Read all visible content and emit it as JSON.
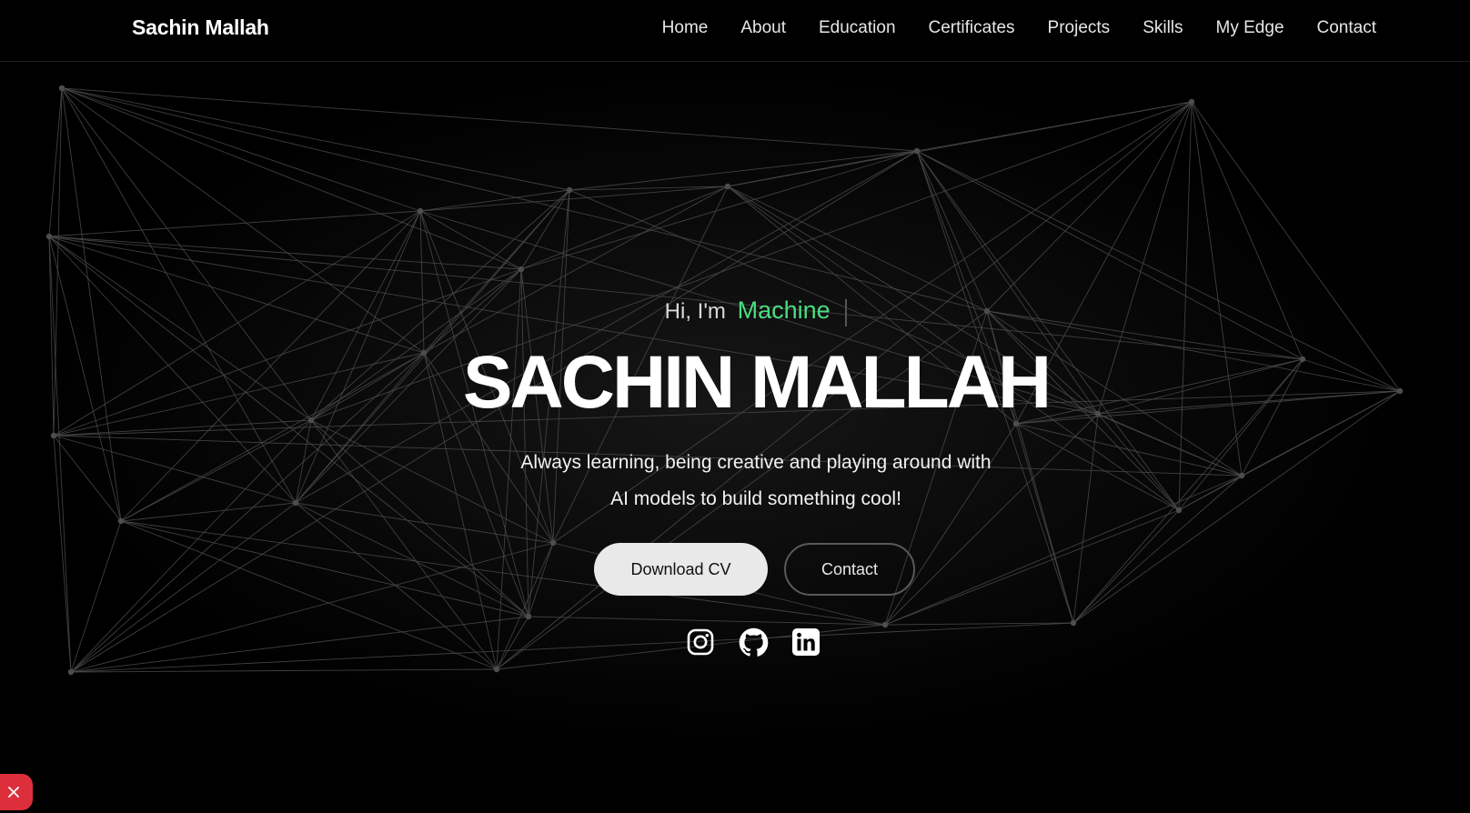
{
  "header": {
    "brand": "Sachin Mallah",
    "nav": [
      "Home",
      "About",
      "Education",
      "Certificates",
      "Projects",
      "Skills",
      "My Edge",
      "Contact"
    ]
  },
  "hero": {
    "greeting": "Hi, I'm",
    "role": "Machine",
    "name": "SACHIN MALLAH",
    "tagline_line1": "Always learning, being creative and playing around with",
    "tagline_line2": "AI models to build something cool!",
    "download_button": "Download CV",
    "contact_button": "Contact",
    "socials": [
      "instagram-icon",
      "github-icon",
      "linkedin-icon"
    ]
  },
  "floating_button": {
    "icon": "close-icon",
    "color": "#dc2f3b"
  },
  "colors": {
    "background": "#000000",
    "accent": "#4ade80",
    "network_line": "#4a4a4a"
  }
}
